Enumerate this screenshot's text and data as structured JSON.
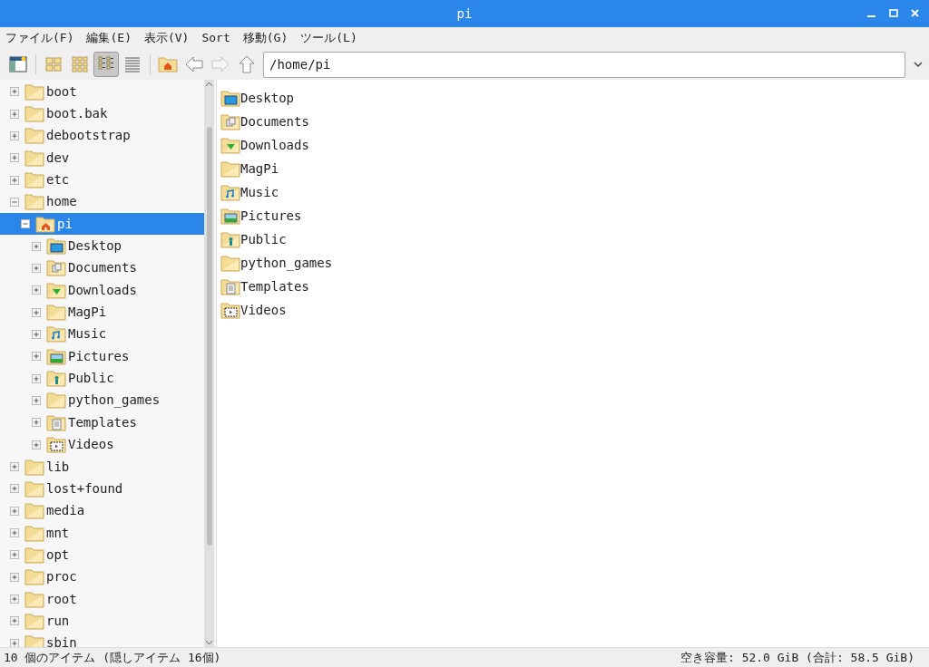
{
  "window": {
    "title": "pi"
  },
  "menu": [
    "ファイル(F)",
    "編集(E)",
    "表示(V)",
    "Sort",
    "移動(G)",
    "ツール(L)"
  ],
  "toolbar": [
    {
      "kind": "sidepane"
    },
    {
      "kind": "sep"
    },
    {
      "kind": "icons",
      "selected": false
    },
    {
      "kind": "thumbs",
      "selected": false
    },
    {
      "kind": "compact",
      "selected": true
    },
    {
      "kind": "list",
      "selected": false
    },
    {
      "kind": "sep"
    },
    {
      "kind": "home"
    },
    {
      "kind": "back",
      "disabled": false
    },
    {
      "kind": "forward",
      "disabled": true
    },
    {
      "kind": "up",
      "disabled": false
    }
  ],
  "location": {
    "value": "/home/pi"
  },
  "tree": [
    {
      "name": "boot",
      "kind": "plain",
      "expanded": false,
      "selected": false
    },
    {
      "name": "boot.bak",
      "kind": "plain",
      "expanded": false,
      "selected": false
    },
    {
      "name": "debootstrap",
      "kind": "plain",
      "expanded": false,
      "selected": false
    },
    {
      "name": "dev",
      "kind": "plain",
      "expanded": false,
      "selected": false
    },
    {
      "name": "etc",
      "kind": "plain",
      "expanded": false,
      "selected": false
    },
    {
      "name": "home",
      "kind": "plain",
      "expanded": true,
      "selected": false,
      "children": [
        {
          "name": "pi",
          "kind": "home",
          "expanded": true,
          "selected": true,
          "children": [
            {
              "name": "Desktop",
              "kind": "desktop",
              "expanded": false,
              "selected": false
            },
            {
              "name": "Documents",
              "kind": "documents",
              "expanded": false,
              "selected": false
            },
            {
              "name": "Downloads",
              "kind": "downloads",
              "expanded": false,
              "selected": false
            },
            {
              "name": "MagPi",
              "kind": "plain",
              "expanded": false,
              "selected": false
            },
            {
              "name": "Music",
              "kind": "music",
              "expanded": false,
              "selected": false
            },
            {
              "name": "Pictures",
              "kind": "pictures",
              "expanded": false,
              "selected": false
            },
            {
              "name": "Public",
              "kind": "public",
              "expanded": false,
              "selected": false
            },
            {
              "name": "python_games",
              "kind": "plain",
              "expanded": false,
              "selected": false
            },
            {
              "name": "Templates",
              "kind": "templates",
              "expanded": false,
              "selected": false
            },
            {
              "name": "Videos",
              "kind": "videos",
              "expanded": false,
              "selected": false
            }
          ]
        }
      ]
    },
    {
      "name": "lib",
      "kind": "plain",
      "expanded": false,
      "selected": false
    },
    {
      "name": "lost+found",
      "kind": "plain",
      "expanded": false,
      "selected": false
    },
    {
      "name": "media",
      "kind": "plain",
      "expanded": false,
      "selected": false
    },
    {
      "name": "mnt",
      "kind": "plain",
      "expanded": false,
      "selected": false
    },
    {
      "name": "opt",
      "kind": "plain",
      "expanded": false,
      "selected": false
    },
    {
      "name": "proc",
      "kind": "plain",
      "expanded": false,
      "selected": false
    },
    {
      "name": "root",
      "kind": "plain",
      "expanded": false,
      "selected": false
    },
    {
      "name": "run",
      "kind": "plain",
      "expanded": false,
      "selected": false
    },
    {
      "name": "sbin",
      "kind": "plain",
      "expanded": false,
      "selected": false
    }
  ],
  "files": [
    {
      "name": "Desktop",
      "kind": "desktop"
    },
    {
      "name": "Documents",
      "kind": "documents"
    },
    {
      "name": "Downloads",
      "kind": "downloads"
    },
    {
      "name": "MagPi",
      "kind": "plain"
    },
    {
      "name": "Music",
      "kind": "music"
    },
    {
      "name": "Pictures",
      "kind": "pictures"
    },
    {
      "name": "Public",
      "kind": "public"
    },
    {
      "name": "python_games",
      "kind": "plain"
    },
    {
      "name": "Templates",
      "kind": "templates"
    },
    {
      "name": "Videos",
      "kind": "videos"
    }
  ],
  "status_bar": {
    "items": "10 個のアイテム (隠しアイテム 16個)",
    "space": "空き容量: 52.0 GiB (合計: 58.5 GiB)"
  }
}
